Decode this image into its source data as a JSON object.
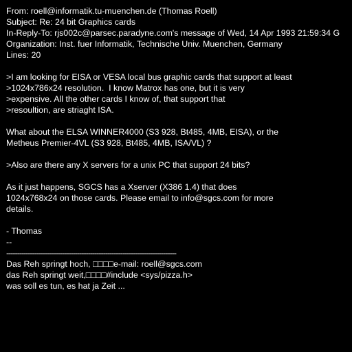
{
  "headers": {
    "from": "From: roell@informatik.tu-muenchen.de (Thomas Roell)",
    "subject": "Subject: Re: 24 bit Graphics cards",
    "in_reply_to": "In-Reply-To: rjs002c@parsec.paradyne.com's message of Wed, 14 Apr 1993 21:59:34 G",
    "organization": "Organization: Inst. fuer Informatik, Technische Univ. Muenchen, Germany",
    "lines": "Lines: 20"
  },
  "body": {
    "quote1": [
      ">I am looking for EISA or VESA local bus graphic cards that support at least",
      ">1024x786x24 resolution.  I know Matrox has one, but it is very",
      ">expensive. All the other cards I know of, that support that",
      ">resoultion, are striaght ISA."
    ],
    "reply1": [
      "What about the ELSA WINNER4000 (S3 928, Bt485, 4MB, EISA), or the",
      "Metheus Premier-4VL (S3 928, Bt485, 4MB, ISA/VL) ?"
    ],
    "quote2": [
      ">Also are there any X servers for a unix PC that support 24 bits?"
    ],
    "reply2": [
      "As it just happens, SGCS has a Xserver (X386 1.4) that does",
      "1024x768x24 on those cards. Please email to info@sgcs.com for more",
      "details."
    ],
    "signoff": "- Thomas"
  },
  "signature": {
    "separator": "--",
    "divider": "-------------------------------------------------------------------------------",
    "lines": [
      "Das Reh springt hoch, □□□□e-mail: roell@sgcs.com",
      "das Reh springt weit,□□□□#include <sys/pizza.h>",
      "was soll es tun, es hat ja Zeit ..."
    ]
  }
}
